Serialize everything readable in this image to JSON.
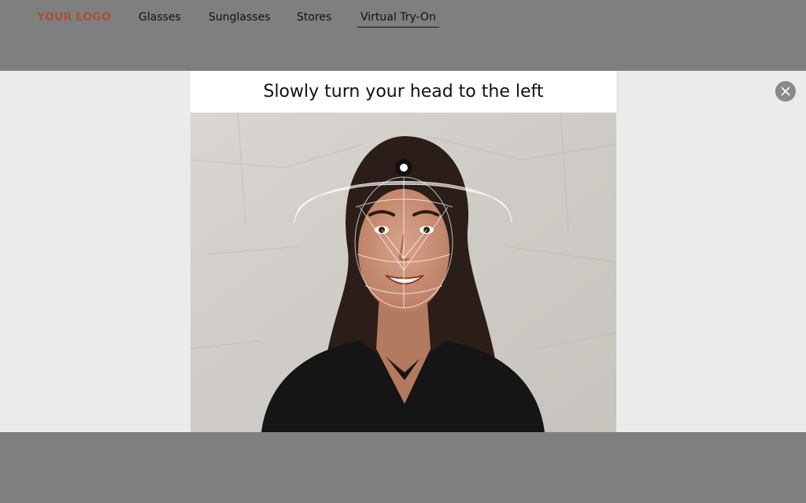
{
  "header": {
    "logo": "YOUR LOGO",
    "nav": [
      {
        "label": "Glasses"
      },
      {
        "label": "Sunglasses"
      },
      {
        "label": "Stores"
      },
      {
        "label": "Virtual Try-On"
      }
    ]
  },
  "modal": {
    "instruction": "Slowly turn your head to the left",
    "close_icon": "close-icon"
  }
}
